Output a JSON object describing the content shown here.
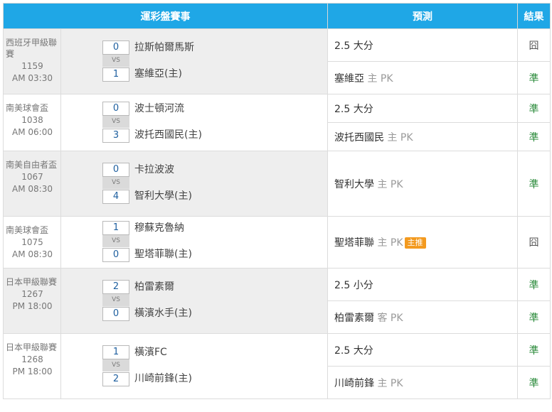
{
  "header": {
    "event": "運彩盤賽事",
    "prediction": "預測",
    "result": "結果"
  },
  "games": [
    {
      "league": "西班牙甲級聯賽",
      "code": "1159",
      "time": "AM 03:30",
      "home_score": "0",
      "away_score": "1",
      "vs": "VS",
      "team_a": "拉斯帕爾馬斯",
      "team_b": "塞維亞(主)",
      "predictions": [
        {
          "main": "2.5 大分",
          "side": "",
          "tag": "",
          "result": "囧",
          "result_type": "lose"
        },
        {
          "main": "塞維亞",
          "side": "主 PK",
          "tag": "",
          "result": "準",
          "result_type": "win"
        }
      ]
    },
    {
      "league": "南美球會盃",
      "code": "1038",
      "time": "AM 06:00",
      "home_score": "0",
      "away_score": "3",
      "vs": "VS",
      "team_a": "波士頓河流",
      "team_b": "波托西國民(主)",
      "predictions": [
        {
          "main": "2.5 大分",
          "side": "",
          "tag": "",
          "result": "準",
          "result_type": "win"
        },
        {
          "main": "波托西國民",
          "side": "主 PK",
          "tag": "",
          "result": "準",
          "result_type": "win"
        }
      ]
    },
    {
      "league": "南美自由者盃",
      "code": "1067",
      "time": "AM 08:30",
      "home_score": "0",
      "away_score": "4",
      "vs": "VS",
      "team_a": "卡拉波波",
      "team_b": "智利大學(主)",
      "predictions": [
        {
          "main": "智利大學",
          "side": "主 PK",
          "tag": "",
          "result": "準",
          "result_type": "win"
        }
      ]
    },
    {
      "league": "南美球會盃",
      "code": "1075",
      "time": "AM 08:30",
      "home_score": "1",
      "away_score": "0",
      "vs": "VS",
      "team_a": "穆蘇克魯納",
      "team_b": "聖塔菲聯(主)",
      "predictions": [
        {
          "main": "聖塔菲聯",
          "side": "主 PK",
          "tag": "主推",
          "result": "囧",
          "result_type": "lose"
        }
      ]
    },
    {
      "league": "日本甲級聯賽",
      "code": "1267",
      "time": "PM 18:00",
      "home_score": "2",
      "away_score": "0",
      "vs": "VS",
      "team_a": "柏雷素爾",
      "team_b": "橫濱水手(主)",
      "predictions": [
        {
          "main": "2.5 小分",
          "side": "",
          "tag": "",
          "result": "準",
          "result_type": "win"
        },
        {
          "main": "柏雷素爾",
          "side": "客 PK",
          "tag": "",
          "result": "準",
          "result_type": "win"
        }
      ]
    },
    {
      "league": "日本甲級聯賽",
      "code": "1268",
      "time": "PM 18:00",
      "home_score": "1",
      "away_score": "2",
      "vs": "VS",
      "team_a": "橫濱FC",
      "team_b": "川崎前鋒(主)",
      "predictions": [
        {
          "main": "2.5 大分",
          "side": "",
          "tag": "",
          "result": "準",
          "result_type": "win"
        },
        {
          "main": "川崎前鋒",
          "side": "主 PK",
          "tag": "",
          "result": "準",
          "result_type": "win"
        }
      ]
    }
  ]
}
